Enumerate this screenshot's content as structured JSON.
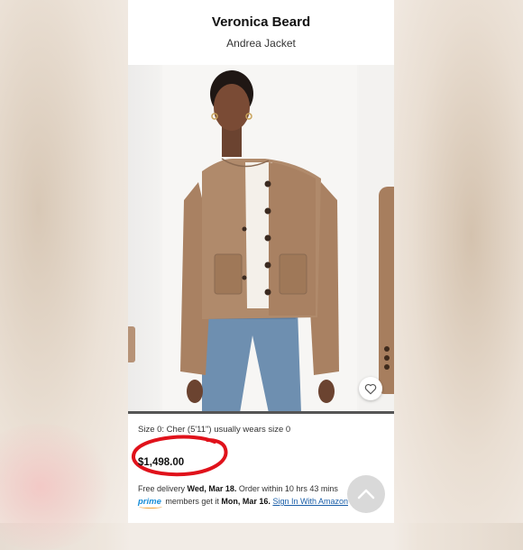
{
  "header": {
    "brand": "Veronica Beard",
    "product_name": "Andrea Jacket"
  },
  "gallery": {
    "current_index": 1,
    "progress": 1.0,
    "favorite_icon": "heart-outline-icon"
  },
  "details": {
    "size_note": "Size 0: Cher (5'11\") usually wears size 0",
    "price": "$1,498.00",
    "delivery_prefix": "Free delivery ",
    "delivery_date": "Wed, Mar 18.",
    "delivery_suffix": " Order within 10 hrs 43 mins",
    "prime_logo": "prime",
    "prime_text": " members get it ",
    "prime_date": "Mon, Mar 16.",
    "signin_link": "Sign In With Amazon"
  },
  "scroll_top": {
    "icon": "chevron-up-icon"
  },
  "colors": {
    "price_annotation": "#e0121b",
    "prime_blue": "#1a8ed8",
    "link": "#1a5ea8"
  }
}
